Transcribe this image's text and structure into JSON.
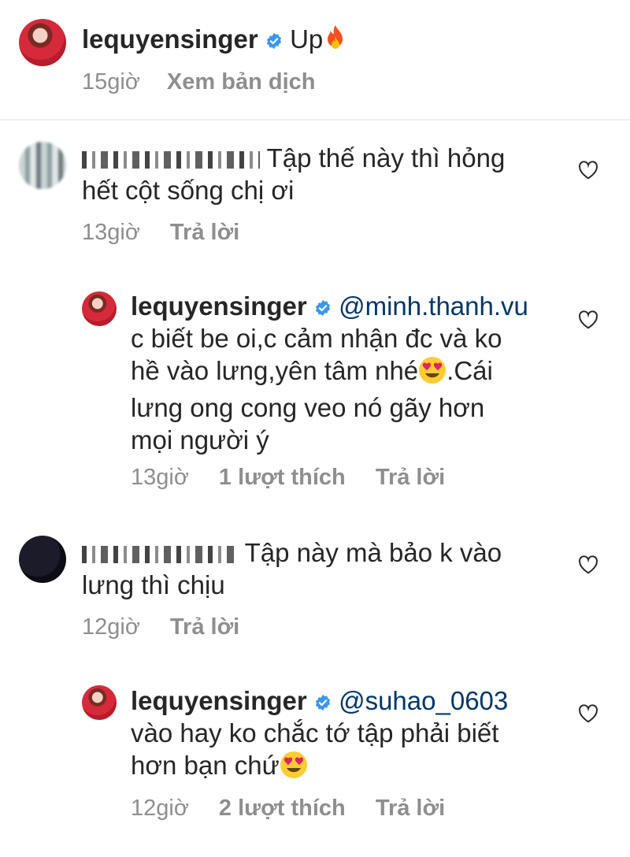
{
  "post": {
    "username": "lequyensinger",
    "caption": "Up",
    "caption_emoji": "fire",
    "time": "15giờ",
    "translate_label": "Xem bản dịch"
  },
  "comments": [
    {
      "username_hidden": true,
      "text_line1": "Tập thế này thì hỏng",
      "text_line2": "hết cột sống chị ơi",
      "time": "13giờ",
      "reply_label": "Trả lời"
    },
    {
      "username": "lequyensinger",
      "mention": "@minh.thanh.vu",
      "line1": "c biết be oi,c cảm nhận đc và ko",
      "line2a": "hề vào lưng,yên tâm nhé",
      "line2b": ".Cái",
      "line3": "lưng ong cong veo nó gãy hơn",
      "line4": "mọi người ý",
      "time": "13giờ",
      "likes": "1 lượt thích",
      "reply_label": "Trả lời"
    },
    {
      "username_hidden": true,
      "text_line1": "Tập này mà bảo k vào",
      "text_line2": "lưng thì chịu",
      "time": "12giờ",
      "reply_label": "Trả lời"
    },
    {
      "username": "lequyensinger",
      "mention": "@suhao_0603",
      "line1": "vào hay ko chắc tớ tập phải biết",
      "line2": "hơn bạn chứ",
      "time": "12giờ",
      "likes": "2 lượt thích",
      "reply_label": "Trả lời"
    }
  ],
  "colors": {
    "text": "#262626",
    "meta": "#8e8e8e",
    "mention": "#00376b",
    "verified": "#3897f0"
  }
}
